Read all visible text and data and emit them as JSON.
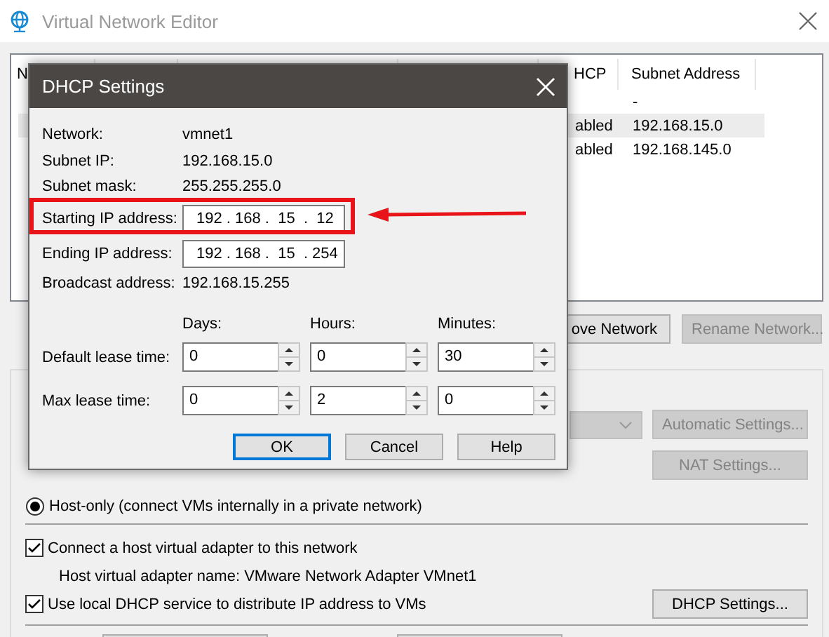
{
  "window": {
    "title": "Virtual Network Editor"
  },
  "network_list": {
    "columns": [
      "N",
      "HCP",
      "Subnet Address"
    ],
    "rows": [
      {
        "subnet_address": "-",
        "selected": false
      },
      {
        "dhcp": "abled",
        "subnet_address": "192.168.15.0",
        "selected": true
      },
      {
        "dhcp": "abled",
        "subnet_address": "192.168.145.0",
        "selected": false
      }
    ]
  },
  "list_buttons": [
    {
      "label": "ove Network",
      "disabled": false
    },
    {
      "label": "Rename Network...",
      "disabled": true
    }
  ],
  "settings_group": {
    "nat_dropdown": {
      "disabled": true
    },
    "automatic_settings": {
      "label": "Automatic Settings...",
      "disabled": true
    },
    "nat_settings": {
      "label": "NAT Settings...",
      "disabled": true
    },
    "host_only": {
      "label": "Host-only (connect VMs internally in a private network)",
      "selected": true
    },
    "connect_adapter": {
      "label": "Connect a host virtual adapter to this network",
      "checked": true
    },
    "adapter_name": "Host virtual adapter name: VMware Network Adapter VMnet1",
    "use_dhcp": {
      "label": "Use local DHCP service to distribute IP address to VMs",
      "checked": true
    },
    "dhcp_settings": {
      "label": "DHCP Settings...",
      "disabled": false
    }
  },
  "dialog": {
    "title": "DHCP Settings",
    "info": [
      {
        "label": "Network:",
        "value": "vmnet1"
      },
      {
        "label": "Subnet IP:",
        "value": "192.168.15.0"
      },
      {
        "label": "Subnet mask:",
        "value": "255.255.255.0"
      }
    ],
    "ip_fields": [
      {
        "label": "Starting IP address:",
        "value": "192 . 168 .  15  .  12",
        "highlighted": true
      },
      {
        "label": "Ending IP address:",
        "value": "192 . 168 .  15  . 254",
        "highlighted": false
      }
    ],
    "broadcast": {
      "label": "Broadcast address:",
      "value": "192.168.15.255"
    },
    "lease_headers": [
      "Days:",
      "Hours:",
      "Minutes:"
    ],
    "leases": [
      {
        "label": "Default lease time:",
        "values": [
          "0",
          "0",
          "30"
        ]
      },
      {
        "label": "Max lease time:",
        "values": [
          "0",
          "2",
          "0"
        ]
      }
    ],
    "buttons": [
      {
        "label": "OK",
        "default": true
      },
      {
        "label": "Cancel",
        "default": false
      },
      {
        "label": "Help",
        "default": false
      }
    ]
  }
}
